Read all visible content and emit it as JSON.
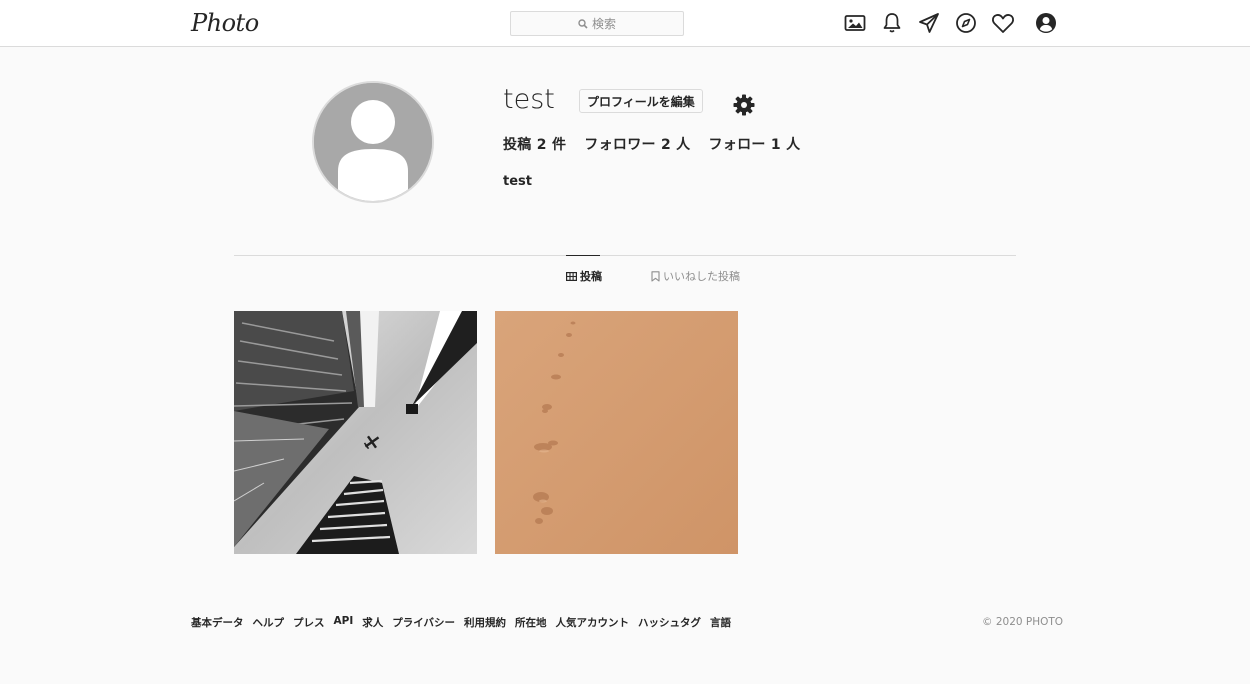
{
  "header": {
    "logo": "Photo",
    "search_placeholder": "検索",
    "icons": [
      "image-icon",
      "bell-icon",
      "paper-plane-icon",
      "compass-icon",
      "heart-icon",
      "user-circle-icon"
    ]
  },
  "profile": {
    "username": "test",
    "edit_button": "プロフィールを編集",
    "posts_count": "投稿 2 件",
    "followers_count": "フォロワー 2 人",
    "following_count": "フォロー 1 人",
    "bio_name": "test"
  },
  "tabs": [
    {
      "label": "投稿",
      "icon": "grid-icon",
      "active": true
    },
    {
      "label": "いいねした投稿",
      "icon": "bookmark-icon",
      "active": false
    }
  ],
  "posts": [
    {
      "subject": "skyscrapers-with-airplane"
    },
    {
      "subject": "footprints-in-sand"
    }
  ],
  "footer": {
    "links": [
      "基本データ",
      "ヘルプ",
      "プレス",
      "API",
      "求人",
      "プライバシー",
      "利用規約",
      "所在地",
      "人気アカウント",
      "ハッシュタグ",
      "言語"
    ],
    "copyright": "© 2020 PHOTO"
  },
  "colors": {
    "background": "#fafafa",
    "border": "#dbdbdb",
    "text": "#262626",
    "muted": "#8e8e8e"
  }
}
